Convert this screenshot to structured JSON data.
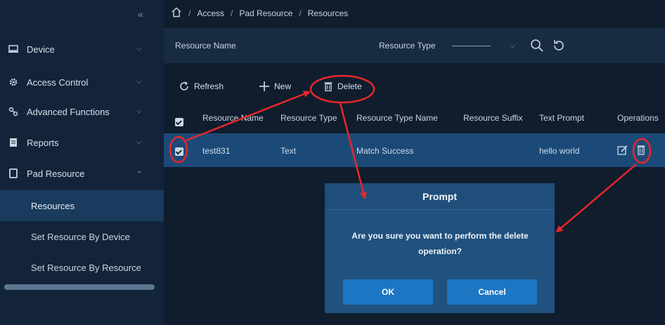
{
  "sidebar": {
    "collapse_glyph": "«",
    "menu": [
      {
        "label": "Device",
        "icon": "device-icon"
      },
      {
        "label": "Access Control",
        "icon": "gear-icon"
      },
      {
        "label": "Advanced Functions",
        "icon": "functions-icon"
      },
      {
        "label": "Reports",
        "icon": "report-icon"
      },
      {
        "label": "Pad Resource",
        "icon": "tablet-icon"
      }
    ],
    "submenu": [
      {
        "label": "Resources",
        "active": true
      },
      {
        "label": "Set Resource By Device"
      },
      {
        "label": "Set Resource By Resource"
      }
    ]
  },
  "breadcrumb": {
    "items": [
      "Access",
      "Pad Resource",
      "Resources"
    ],
    "separator": "/"
  },
  "search": {
    "resource_name_label": "Resource Name",
    "resource_type_label": "Resource Type"
  },
  "toolbar": {
    "refresh": "Refresh",
    "new": "New",
    "delete": "Delete"
  },
  "table": {
    "headers": [
      "Resource Name",
      "Resource Type",
      "Resource Type Name",
      "Resource Suffix",
      "Text Prompt",
      "Operations"
    ],
    "rows": [
      {
        "name": "test831",
        "type": "Text",
        "type_name": "Match Success",
        "suffix": "",
        "prompt": "hello world",
        "checked": true
      }
    ]
  },
  "modal": {
    "title": "Prompt",
    "message": "Are you sure you want to perform the delete operation?",
    "ok": "OK",
    "cancel": "Cancel"
  },
  "colors": {
    "accent": "#1c76c4",
    "annotation": "#e8262b",
    "row_selected": "#1c4a78"
  }
}
